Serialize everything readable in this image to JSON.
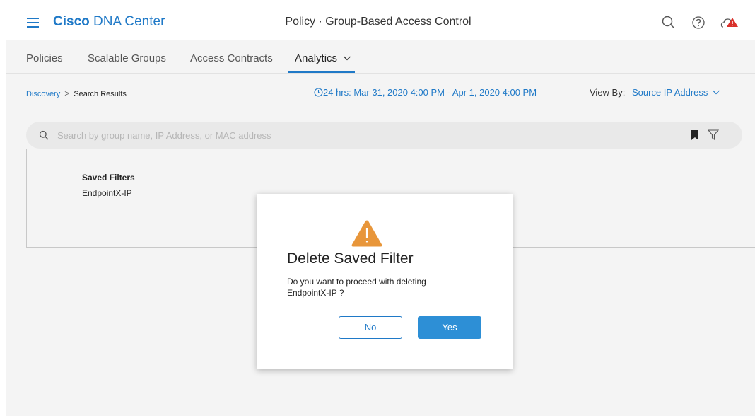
{
  "header": {
    "brand_bold": "Cisco",
    "brand_rest": "DNA Center",
    "title": "Policy · Group-Based Access Control",
    "icons": [
      "menu-icon",
      "search-icon",
      "help-icon",
      "alert-cloud-icon"
    ]
  },
  "tabs": [
    {
      "label": "Policies",
      "active": false
    },
    {
      "label": "Scalable Groups",
      "active": false
    },
    {
      "label": "Access Contracts",
      "active": false
    },
    {
      "label": "Analytics",
      "active": true
    }
  ],
  "breadcrumb": {
    "parent": "Discovery",
    "current": "Search Results"
  },
  "time_range": "24 hrs:  Mar 31, 2020 4:00 PM - Apr 1, 2020 4:00 PM",
  "view_by": {
    "label": "View By:",
    "value": "Source IP Address"
  },
  "search": {
    "placeholder": "Search by group name, IP Address, or MAC address",
    "value": ""
  },
  "saved_filters": {
    "title": "Saved Filters",
    "items": [
      "EndpointX-IP"
    ]
  },
  "dialog": {
    "title": "Delete Saved Filter",
    "message": "Do you want to proceed with deleting EndpointX-IP ?",
    "no_label": "No",
    "yes_label": "Yes"
  },
  "colors": {
    "brand_blue": "#1f79c7",
    "primary_button": "#2d8fd6",
    "warning": "#e8963a",
    "alert": "#d9312b"
  }
}
